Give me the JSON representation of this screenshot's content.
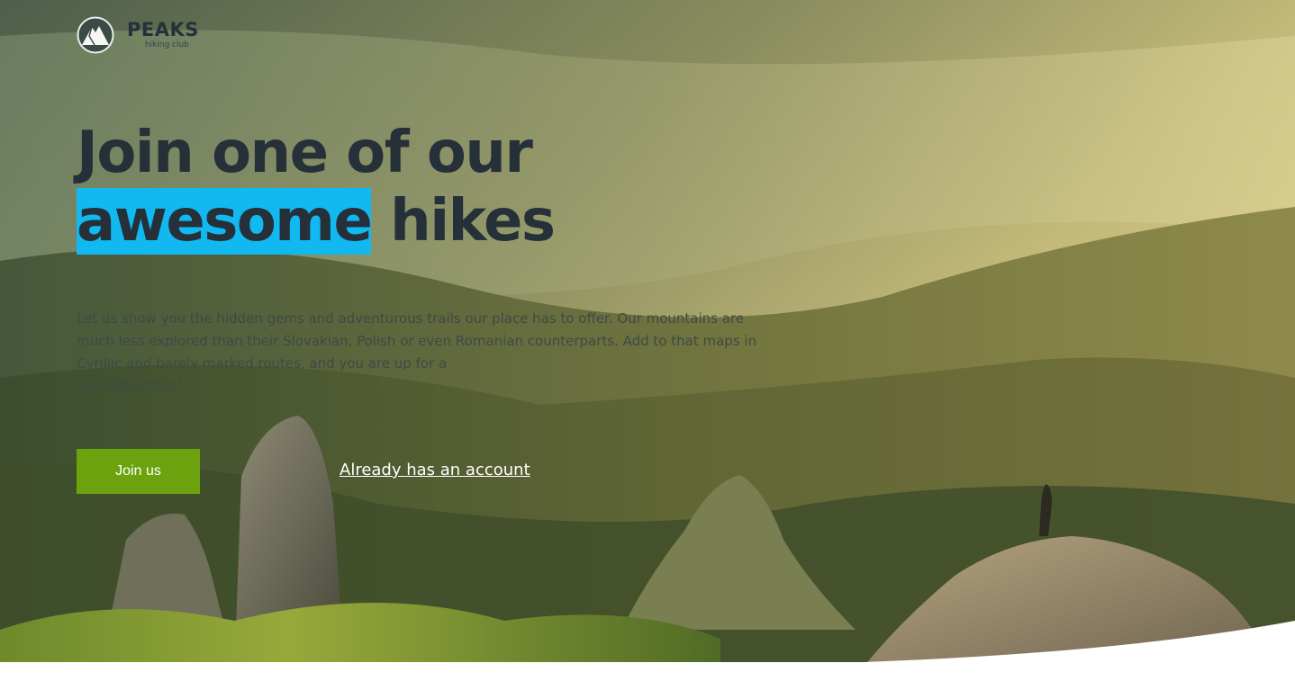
{
  "brand": {
    "name": "PEAKS",
    "tagline": "hiking club",
    "logo_icon": "mountain-peak-icon"
  },
  "hero": {
    "headline_line1": "Join one of our",
    "headline_highlight": "awesome",
    "headline_line2_rest": " hikes",
    "description_lines": [
      "Let us show you the hidden gems and adventurous trails our place has to offer. Our mountains are",
      "much less explored than their Slovakian, Polish or even Romanian counterparts. Add to that maps in",
      "Cyrillic and barely marked routes, and you are up for a",
      "true adventure!"
    ],
    "primary_button": "Join us",
    "secondary_link": "Already has an account"
  },
  "colors": {
    "highlight": "#12b8f0",
    "button": "#6da20f",
    "heading": "#263039"
  }
}
